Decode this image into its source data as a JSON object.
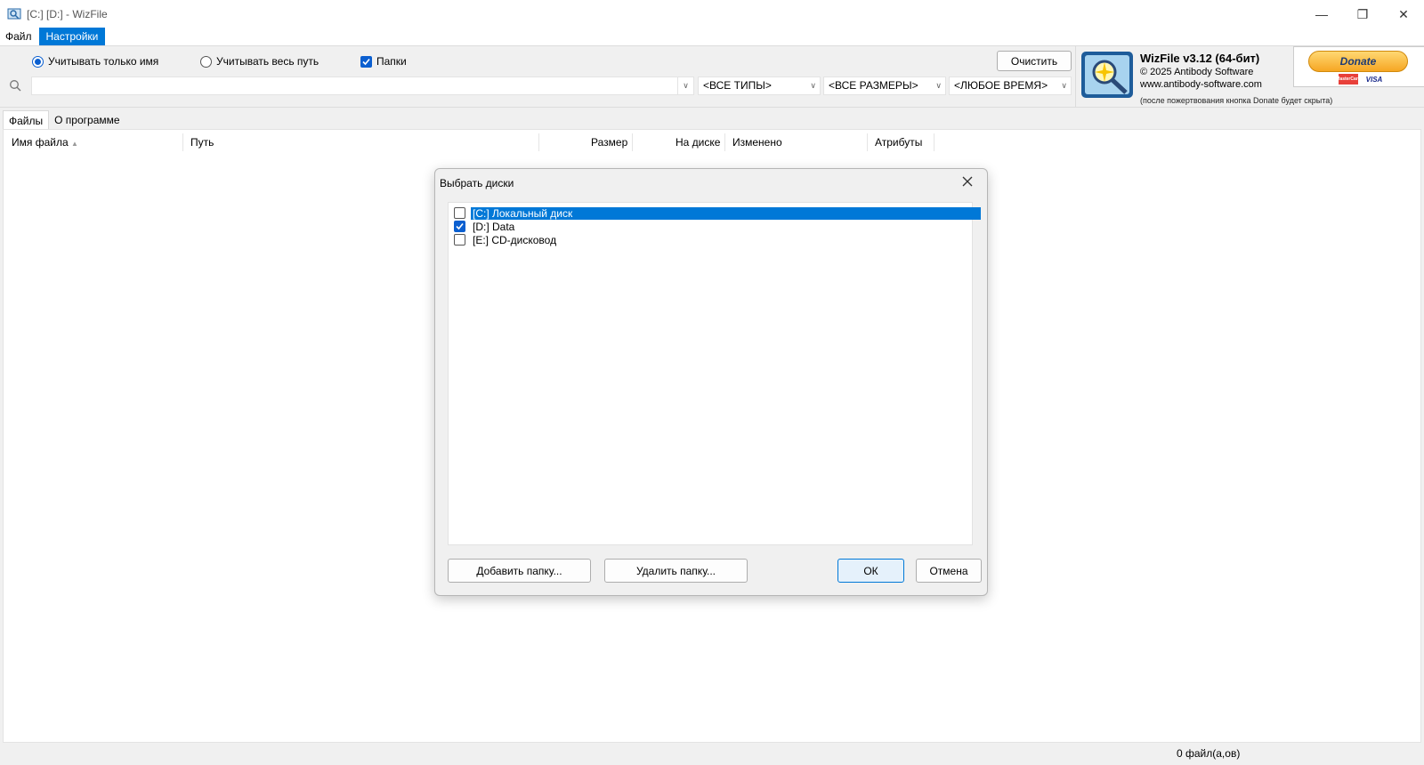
{
  "window": {
    "title": "[C:] [D:]  - WizFile",
    "icon": "wizfile-app-icon",
    "controls": {
      "minimize": "—",
      "restore": "❐",
      "close": "✕"
    }
  },
  "menu": {
    "items": [
      "Файл",
      "Настройки"
    ],
    "active_index": 1
  },
  "toolbar": {
    "radio_name_only": "Учитывать только имя",
    "radio_full_path": "Учитывать весь путь",
    "check_folders": "Папки",
    "clear_button": "Очистить",
    "search_value": "",
    "type_filter": "<ВСЕ ТИПЫ>",
    "size_filter": "<ВСЕ РАЗМЕРЫ>",
    "time_filter": "<ЛЮБОЕ ВРЕМЯ>"
  },
  "info": {
    "product": "WizFile v3.12 (64-бит)",
    "copyright": "© 2025 Antibody Software",
    "website": "www.antibody-software.com",
    "note": "(после пожертвования кнопка Donate будет скрыта)",
    "donate_label": "Donate",
    "card_labels": [
      "MasterCard",
      "VISA"
    ]
  },
  "tabs": [
    {
      "label": "Файлы",
      "active": true
    },
    {
      "label": "О программе",
      "active": false
    }
  ],
  "columns": {
    "name": "Имя файла",
    "path": "Путь",
    "size": "Размер",
    "on_disk": "На диске",
    "modified": "Изменено",
    "attributes": "Атрибуты",
    "sort_indicator": "▲"
  },
  "status": {
    "file_count": "0 файл(а,ов)"
  },
  "dialog": {
    "title": "Выбрать диски",
    "drives": [
      {
        "label": "[C:] Локальный диск",
        "checked": false,
        "selected": true
      },
      {
        "label": "[D:] Data",
        "checked": true,
        "selected": false
      },
      {
        "label": "[E:] CD-дисковод",
        "checked": false,
        "selected": false
      }
    ],
    "add_folder": "Добавить папку...",
    "remove_folder": "Удалить папку...",
    "ok": "ОК",
    "cancel": "Отмена"
  },
  "colors": {
    "accent": "#0078d7",
    "check_blue": "#0b5fd0"
  }
}
